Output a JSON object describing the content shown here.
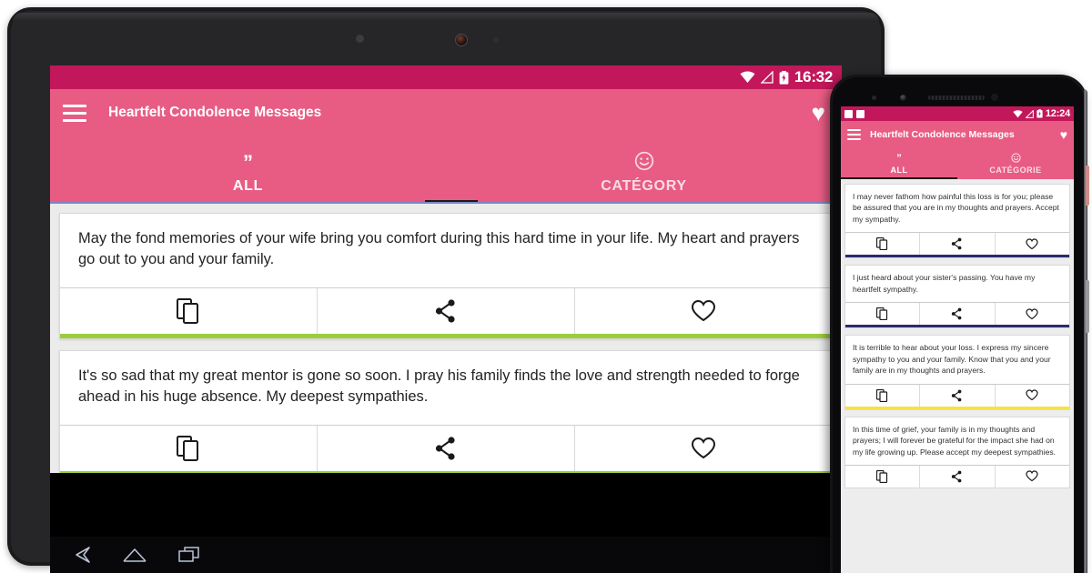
{
  "app": {
    "title": "Heartfelt Condolence Messages",
    "accent_bar_color": "#e85c83",
    "status_bar_color": "#c2185b"
  },
  "tablet": {
    "status_bar": {
      "time": "16:32",
      "icons": [
        "wifi-icon",
        "signal-icon",
        "battery-icon"
      ]
    },
    "appbar": {
      "menu_icon": "hamburger-menu-icon",
      "title": "Heartfelt Condolence Messages",
      "favorite_icon": "heart-filled-icon"
    },
    "tabs": [
      {
        "label": "ALL",
        "icon": "quote-icon",
        "icon_glyph": "”",
        "active": true
      },
      {
        "label": "CATÉGORY",
        "icon": "smiley-icon",
        "icon_glyph": "☺",
        "active": false
      }
    ],
    "cards": [
      {
        "text": "May the fond memories of your wife bring you comfort during this hard time in your life. My heart and prayers go out to you and your family.",
        "accent_color": "#9ccc3c",
        "actions": [
          "copy-icon",
          "share-icon",
          "favorite-heart-icon"
        ]
      },
      {
        "text": "It's so sad that my great mentor is gone so soon. I pray his family finds the love and strength needed to forge ahead in his huge absence. My deepest sympathies.",
        "accent_color": "#9ccc3c",
        "actions": [
          "copy-icon",
          "share-icon",
          "favorite-heart-icon"
        ]
      }
    ],
    "navigation_bar": [
      "back-icon",
      "home-icon",
      "recents-icon"
    ]
  },
  "phone": {
    "status_bar": {
      "time": "12:24",
      "icons": [
        "wifi-icon",
        "signal-icon",
        "battery-icon"
      ]
    },
    "appbar": {
      "menu_icon": "hamburger-menu-icon",
      "title": "Heartfelt Condolence Messages",
      "favorite_icon": "heart-filled-icon"
    },
    "tabs": [
      {
        "label": "ALL",
        "icon": "quote-icon",
        "icon_glyph": "”",
        "active": true
      },
      {
        "label": "CATÉGORIE",
        "icon": "smiley-icon",
        "icon_glyph": "☺",
        "active": false
      }
    ],
    "cards": [
      {
        "text": "I may never fathom how painful this loss is for you; please be assured that you are in my thoughts and prayers. Accept my sympathy.",
        "accent_color": "#2b2b6e",
        "actions": [
          "copy-icon",
          "share-icon",
          "favorite-heart-icon"
        ]
      },
      {
        "text": "I just heard about your sister's passing. You have my heartfelt sympathy.",
        "accent_color": "#2b2b6e",
        "actions": [
          "copy-icon",
          "share-icon",
          "favorite-heart-icon"
        ]
      },
      {
        "text": "It is terrible to hear about your loss. I express my sincere sympathy to you and your family. Know that you and your family are in my thoughts and prayers.",
        "accent_color": "#f5e14a",
        "actions": [
          "copy-icon",
          "share-icon",
          "favorite-heart-icon"
        ]
      },
      {
        "text": "In this time of grief, your family is in my thoughts and prayers; I will forever be grateful for the impact she had on my life growing up. Please accept my deepest sympathies.",
        "accent_color": "#ffffff",
        "actions": [
          "copy-icon",
          "share-icon",
          "favorite-heart-icon"
        ]
      }
    ]
  }
}
